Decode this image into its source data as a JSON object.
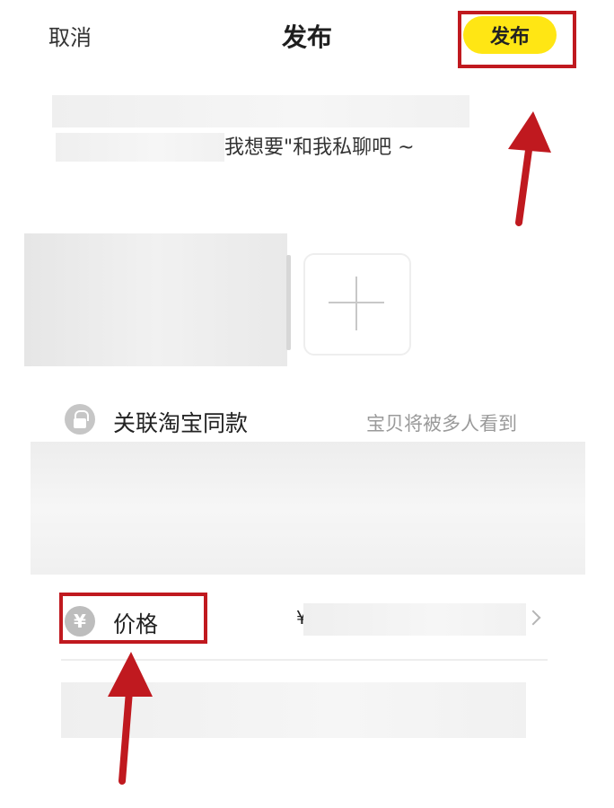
{
  "header": {
    "cancel_label": "取消",
    "title": "发布",
    "publish_label": "发布"
  },
  "description": {
    "visible_text": "我想要\"和我私聊吧 ~"
  },
  "options": {
    "taobao_link": {
      "label": "关联淘宝同款",
      "hint": "宝贝将被多人看到",
      "icon": "lock-icon"
    },
    "price": {
      "label": "价格",
      "icon": "yen-icon",
      "value_partial": "¥"
    }
  },
  "annotations": {
    "highlight_color": "#c0191f"
  },
  "colors": {
    "accent": "#ffe614",
    "hint_text": "#9a9a9a"
  }
}
